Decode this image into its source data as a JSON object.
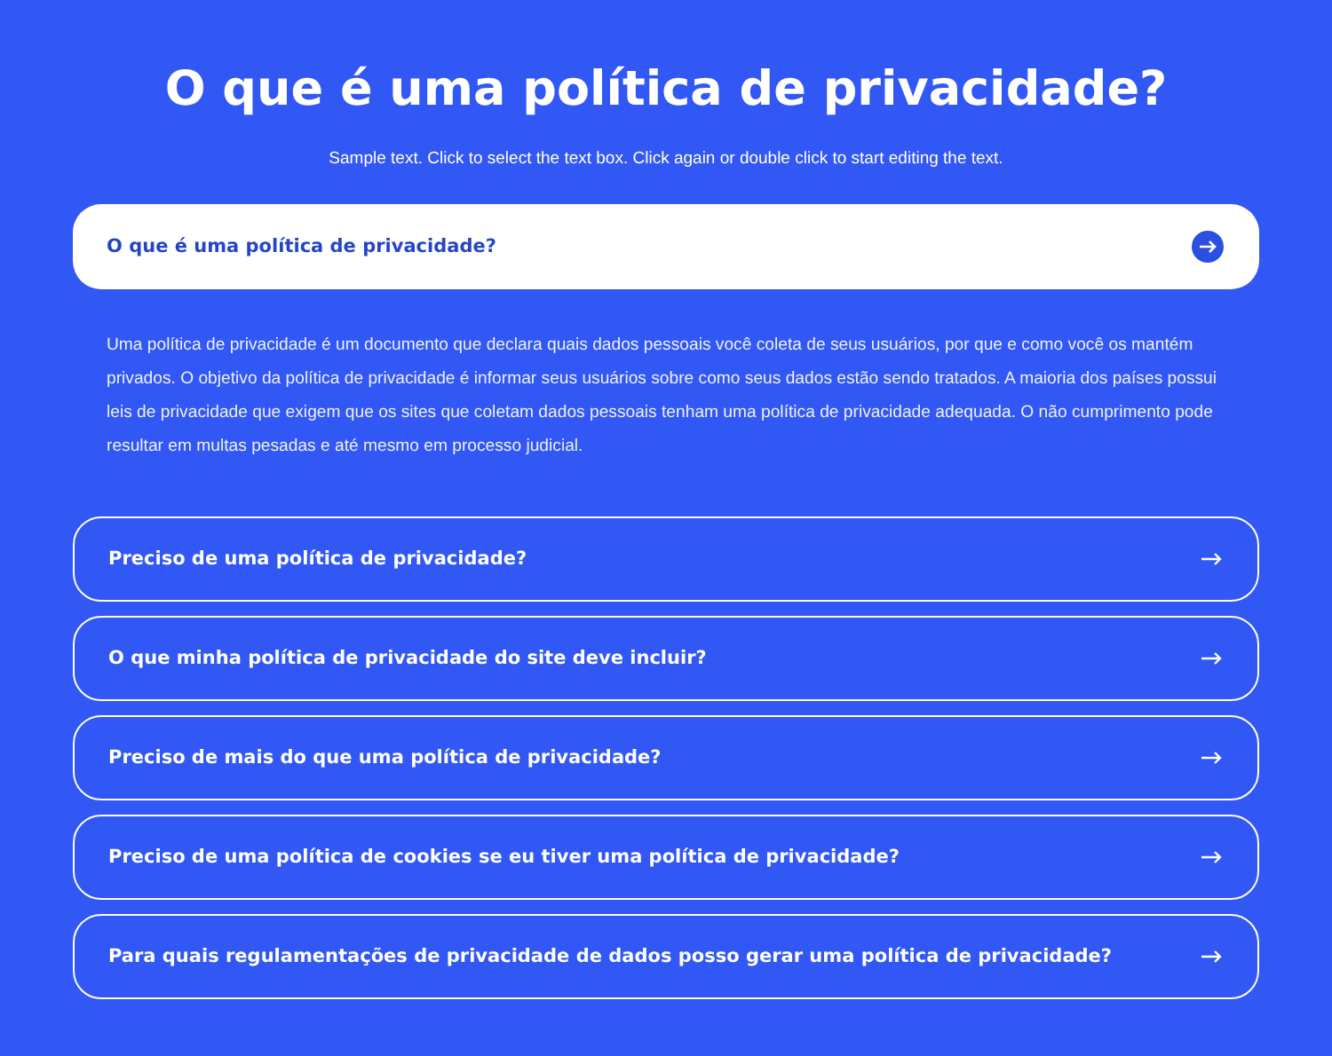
{
  "title": "O que é uma política de privacidade?",
  "subtitle": "Sample text. Click to select the text box. Click again or double click to start editing the text.",
  "faq": [
    {
      "question": "O que é uma política de privacidade?",
      "expanded": true,
      "answer": "Uma política de privacidade é um documento que declara quais dados pessoais você coleta de seus usuários, por que e como você os mantém privados. O objetivo da política de privacidade é informar seus usuários sobre como seus dados estão sendo tratados. A maioria dos países possui leis de privacidade que exigem que os sites que coletam dados pessoais tenham uma política de privacidade adequada. O não cumprimento pode resultar em multas pesadas e até mesmo em processo judicial."
    },
    {
      "question": "Preciso de uma política de privacidade?",
      "expanded": false
    },
    {
      "question": "O que minha política de privacidade do site deve incluir?",
      "expanded": false
    },
    {
      "question": "Preciso de mais do que uma política de privacidade?",
      "expanded": false
    },
    {
      "question": "Preciso de uma política de cookies se eu tiver uma política de privacidade?",
      "expanded": false
    },
    {
      "question": "Para quais regulamentações de privacidade de dados posso gerar uma política de privacidade?",
      "expanded": false
    }
  ]
}
